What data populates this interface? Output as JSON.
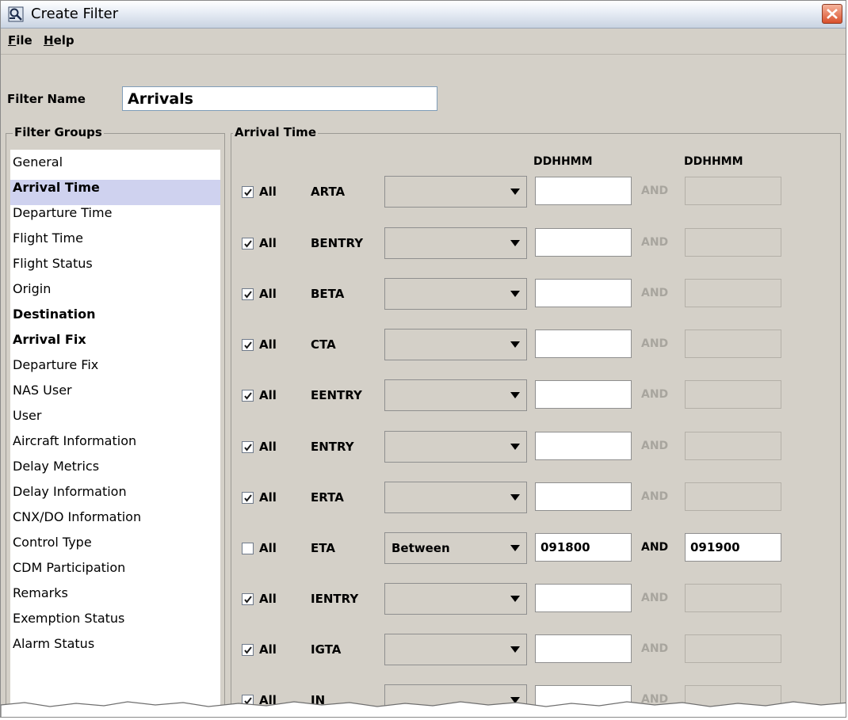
{
  "window": {
    "title": "Create Filter"
  },
  "menu": [
    {
      "hotkey": "F",
      "rest": "ile"
    },
    {
      "hotkey": "H",
      "rest": "elp"
    }
  ],
  "filter_name": {
    "label": "Filter Name",
    "value": "Arrivals"
  },
  "filter_groups": {
    "title": "Filter Groups",
    "items": [
      {
        "label": "General"
      },
      {
        "label": "Arrival Time"
      },
      {
        "label": "Departure Time"
      },
      {
        "label": "Flight Time"
      },
      {
        "label": "Flight Status"
      },
      {
        "label": "Origin"
      },
      {
        "label": "Destination"
      },
      {
        "label": "Arrival Fix"
      },
      {
        "label": "Departure Fix"
      },
      {
        "label": "NAS User"
      },
      {
        "label": "User"
      },
      {
        "label": "Aircraft Information"
      },
      {
        "label": "Delay Metrics"
      },
      {
        "label": "Delay Information"
      },
      {
        "label": "CNX/DO Information"
      },
      {
        "label": "Control Type"
      },
      {
        "label": "CDM Participation"
      },
      {
        "label": "Remarks"
      },
      {
        "label": "Exemption Status"
      },
      {
        "label": "Alarm Status"
      }
    ],
    "selected": "Arrival Time",
    "bold_items": [
      "Destination",
      "Arrival Fix"
    ]
  },
  "panel": {
    "title": "Arrival Time",
    "col1_header": "DDHHMM",
    "col2_header": "DDHHMM",
    "all_label": "All",
    "and_label": "AND",
    "rows": [
      {
        "field": "ARTA",
        "all_checked": true,
        "operator": "",
        "value1": "",
        "value2": ""
      },
      {
        "field": "BENTRY",
        "all_checked": true,
        "operator": "",
        "value1": "",
        "value2": ""
      },
      {
        "field": "BETA",
        "all_checked": true,
        "operator": "",
        "value1": "",
        "value2": ""
      },
      {
        "field": "CTA",
        "all_checked": true,
        "operator": "",
        "value1": "",
        "value2": ""
      },
      {
        "field": "EENTRY",
        "all_checked": true,
        "operator": "",
        "value1": "",
        "value2": ""
      },
      {
        "field": "ENTRY",
        "all_checked": true,
        "operator": "",
        "value1": "",
        "value2": ""
      },
      {
        "field": "ERTA",
        "all_checked": true,
        "operator": "",
        "value1": "",
        "value2": ""
      },
      {
        "field": "ETA",
        "all_checked": false,
        "operator": "Between",
        "value1": "091800",
        "value2": "091900"
      },
      {
        "field": "IENTRY",
        "all_checked": true,
        "operator": "",
        "value1": "",
        "value2": ""
      },
      {
        "field": "IGTA",
        "all_checked": true,
        "operator": "",
        "value1": "",
        "value2": ""
      },
      {
        "field": "IN",
        "all_checked": true,
        "operator": "",
        "value1": "",
        "value2": ""
      }
    ]
  },
  "colors": {
    "window_bg": "#d4d0c8",
    "selection_bg": "#cfd2ef",
    "disabled_text": "#a8a59e",
    "close_button": "#d9502c"
  }
}
